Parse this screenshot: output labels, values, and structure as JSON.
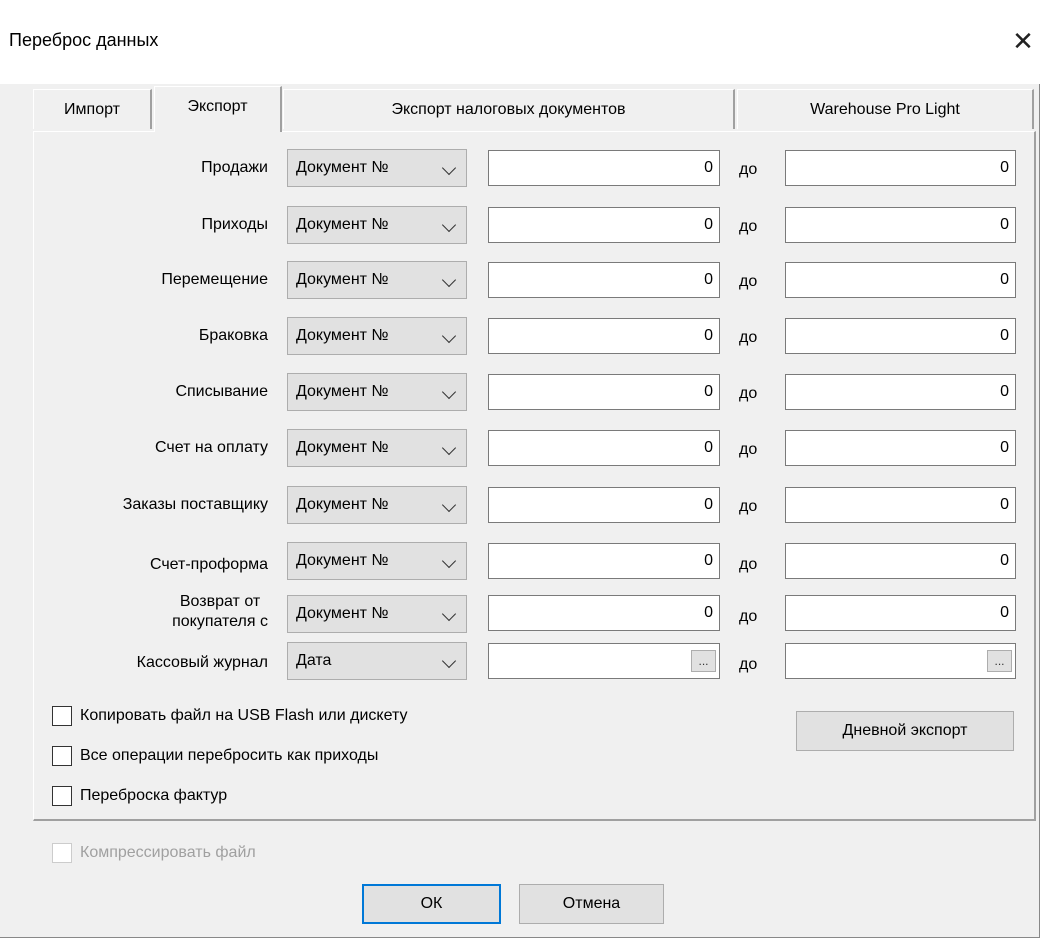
{
  "window": {
    "title": "Переброс данных"
  },
  "tabs": [
    {
      "label": "Импорт"
    },
    {
      "label": "Экспорт"
    },
    {
      "label": "Экспорт налоговых документов"
    },
    {
      "label": "Warehouse Pro Light"
    }
  ],
  "rows": [
    {
      "label": "Продажи",
      "mode": "Документ №",
      "from": "0",
      "sep": "до",
      "to": "0"
    },
    {
      "label": "Приходы",
      "mode": "Документ №",
      "from": "0",
      "sep": "до",
      "to": "0"
    },
    {
      "label": "Перемещение",
      "mode": "Документ №",
      "from": "0",
      "sep": "до",
      "to": "0"
    },
    {
      "label": "Браковка",
      "mode": "Документ №",
      "from": "0",
      "sep": "до",
      "to": "0"
    },
    {
      "label": "Списывание",
      "mode": "Документ №",
      "from": "0",
      "sep": "до",
      "to": "0"
    },
    {
      "label": "Счет на оплату",
      "mode": "Документ №",
      "from": "0",
      "sep": "до",
      "to": "0"
    },
    {
      "label": "Заказы поставщику",
      "mode": "Документ №",
      "from": "0",
      "sep": "до",
      "to": "0"
    },
    {
      "label": "Счет-проформа",
      "mode": "Документ №",
      "from": "0",
      "sep": "до",
      "to": "0"
    },
    {
      "label_line1": "Возврат от",
      "label_line2": "покупателя с",
      "mode": "Документ №",
      "from": "0",
      "sep": "до",
      "to": "0"
    },
    {
      "label": "Кассовый журнал",
      "mode": "Дата",
      "sep": "до",
      "dots": "..."
    }
  ],
  "options": {
    "copy_usb": "Копировать файл на USB Flash или дискету",
    "all_as_income": "Все операции перебросить как приходы",
    "invoices": "Переброска фактур",
    "compress": "Компрессировать файл"
  },
  "buttons": {
    "daily_export": "Дневной экспорт",
    "ok": "ОК",
    "cancel": "Отмена"
  }
}
